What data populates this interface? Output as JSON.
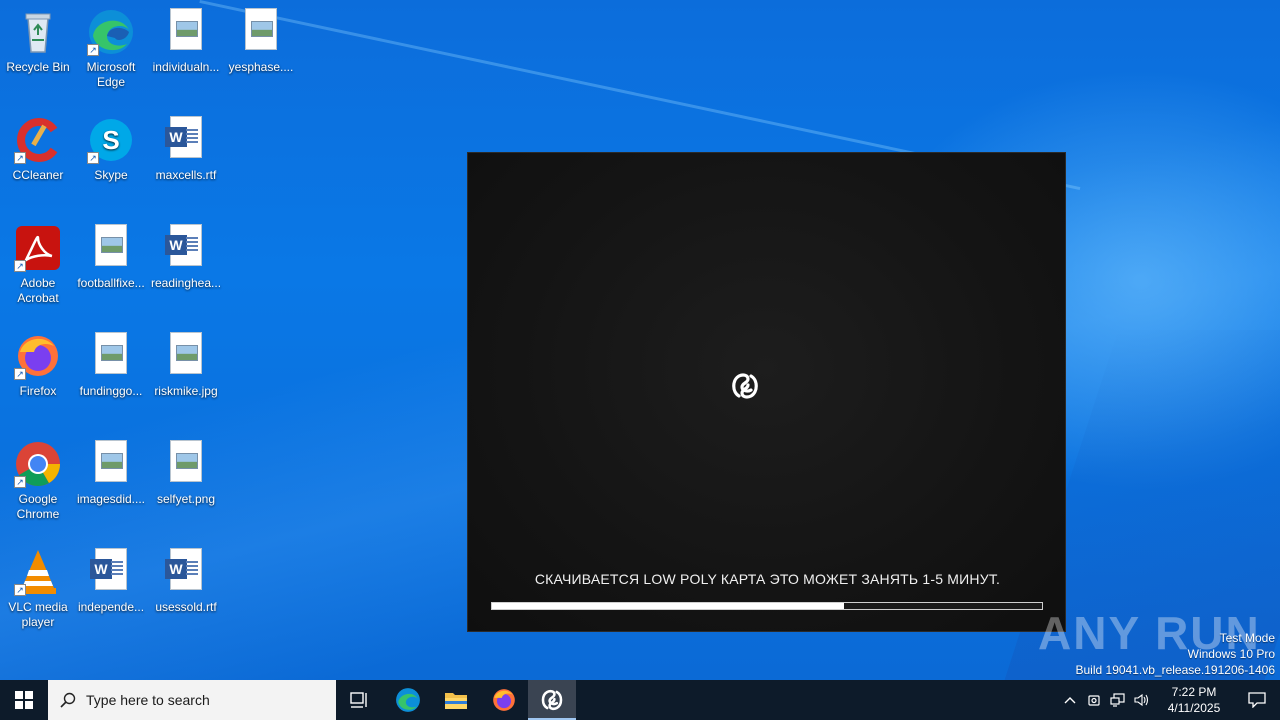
{
  "desktop": {
    "icons": [
      {
        "label": "Recycle Bin",
        "icon": "recycle-bin-icon"
      },
      {
        "label": "Microsoft Edge",
        "icon": "edge-icon"
      },
      {
        "label": "individualn...",
        "icon": "image-file-icon"
      },
      {
        "label": "yesphase....",
        "icon": "image-file-icon"
      },
      {
        "label": "CCleaner",
        "icon": "ccleaner-icon"
      },
      {
        "label": "Skype",
        "icon": "skype-icon"
      },
      {
        "label": "maxcells.rtf",
        "icon": "word-doc-icon"
      },
      {
        "label": "Adobe Acrobat",
        "icon": "acrobat-icon"
      },
      {
        "label": "footballfixe...",
        "icon": "image-file-icon"
      },
      {
        "label": "readinghea...",
        "icon": "word-doc-icon"
      },
      {
        "label": "Firefox",
        "icon": "firefox-icon"
      },
      {
        "label": "fundinggo...",
        "icon": "image-file-icon"
      },
      {
        "label": "riskmike.jpg",
        "icon": "image-file-icon"
      },
      {
        "label": "Google Chrome",
        "icon": "chrome-icon"
      },
      {
        "label": "imagesdid....",
        "icon": "image-file-icon"
      },
      {
        "label": "selfyet.png",
        "icon": "image-file-icon"
      },
      {
        "label": "VLC media player",
        "icon": "vlc-icon"
      },
      {
        "label": "independe...",
        "icon": "word-doc-icon"
      },
      {
        "label": "usessold.rtf",
        "icon": "word-doc-icon"
      }
    ]
  },
  "loader": {
    "status_text": "СКАЧИВАЕТСЯ LOW POLY КАРТА ЭТО МОЖЕТ ЗАНЯТЬ 1-5 МИНУТ.",
    "progress_percent": 64,
    "logo_icon": "app-logo-icon"
  },
  "watermark": {
    "text": "ANY RUN"
  },
  "system_info": {
    "line1": "Test Mode",
    "line2": "Windows 10 Pro",
    "line3": "Build 19041.vb_release.191206-1406"
  },
  "taskbar": {
    "search_placeholder": "Type here to search",
    "pinned": [
      "task-view-icon",
      "edge-icon",
      "file-explorer-icon",
      "firefox-icon",
      "app-logo-icon"
    ],
    "clock_time": "7:22 PM",
    "clock_date": "4/11/2025"
  }
}
